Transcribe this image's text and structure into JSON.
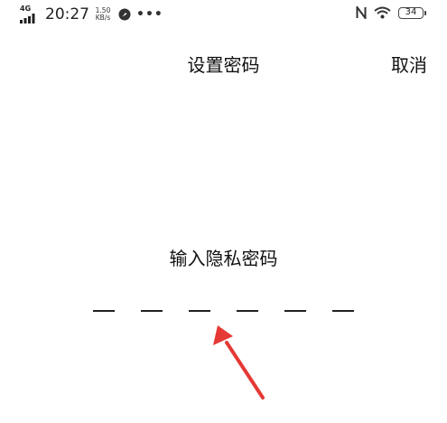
{
  "status_bar": {
    "network_type": "4G",
    "time": "20:27",
    "speed_value": "1.50",
    "speed_unit": "KB/s",
    "battery_level": "34",
    "icons": [
      "signal-icon",
      "app-notification-icon",
      "more-dots-icon",
      "nfc-icon",
      "wifi-icon",
      "battery-icon"
    ]
  },
  "header": {
    "title": "设置密码",
    "cancel_label": "取消"
  },
  "main": {
    "prompt": "输入隐私密码",
    "pin_length": 6
  },
  "annotation": {
    "color": "#e53935",
    "icon": "red-arrow"
  }
}
